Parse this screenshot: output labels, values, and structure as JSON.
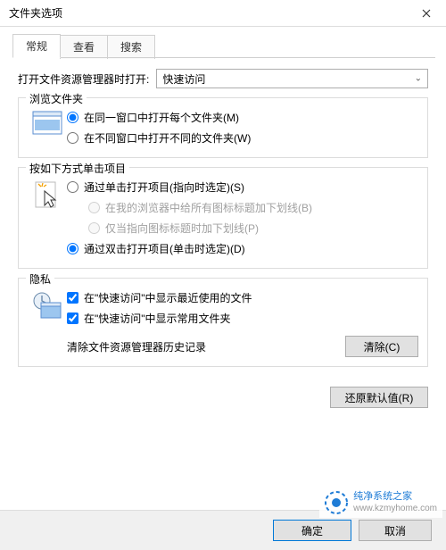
{
  "window": {
    "title": "文件夹选项"
  },
  "tabs": [
    {
      "label": "常规",
      "active": true
    },
    {
      "label": "查看",
      "active": false
    },
    {
      "label": "搜索",
      "active": false
    }
  ],
  "openIn": {
    "label": "打开文件资源管理器时打开:",
    "selected": "快速访问"
  },
  "browse": {
    "title": "浏览文件夹",
    "opt1": "在同一窗口中打开每个文件夹(M)",
    "opt2": "在不同窗口中打开不同的文件夹(W)"
  },
  "click": {
    "title": "按如下方式单击项目",
    "opt1": "通过单击打开项目(指向时选定)(S)",
    "sub1": "在我的浏览器中给所有图标标题加下划线(B)",
    "sub2": "仅当指向图标标题时加下划线(P)",
    "opt2": "通过双击打开项目(单击时选定)(D)"
  },
  "privacy": {
    "title": "隐私",
    "chk1": "在\"快速访问\"中显示最近使用的文件",
    "chk2": "在\"快速访问\"中显示常用文件夹",
    "clearLabel": "清除文件资源管理器历史记录",
    "clearBtn": "清除(C)"
  },
  "restoreBtn": "还原默认值(R)",
  "footer": {
    "ok": "确定",
    "cancel": "取消"
  },
  "watermark": {
    "brand": "纯净系统之家",
    "url": "www.kzmyhome.com"
  }
}
